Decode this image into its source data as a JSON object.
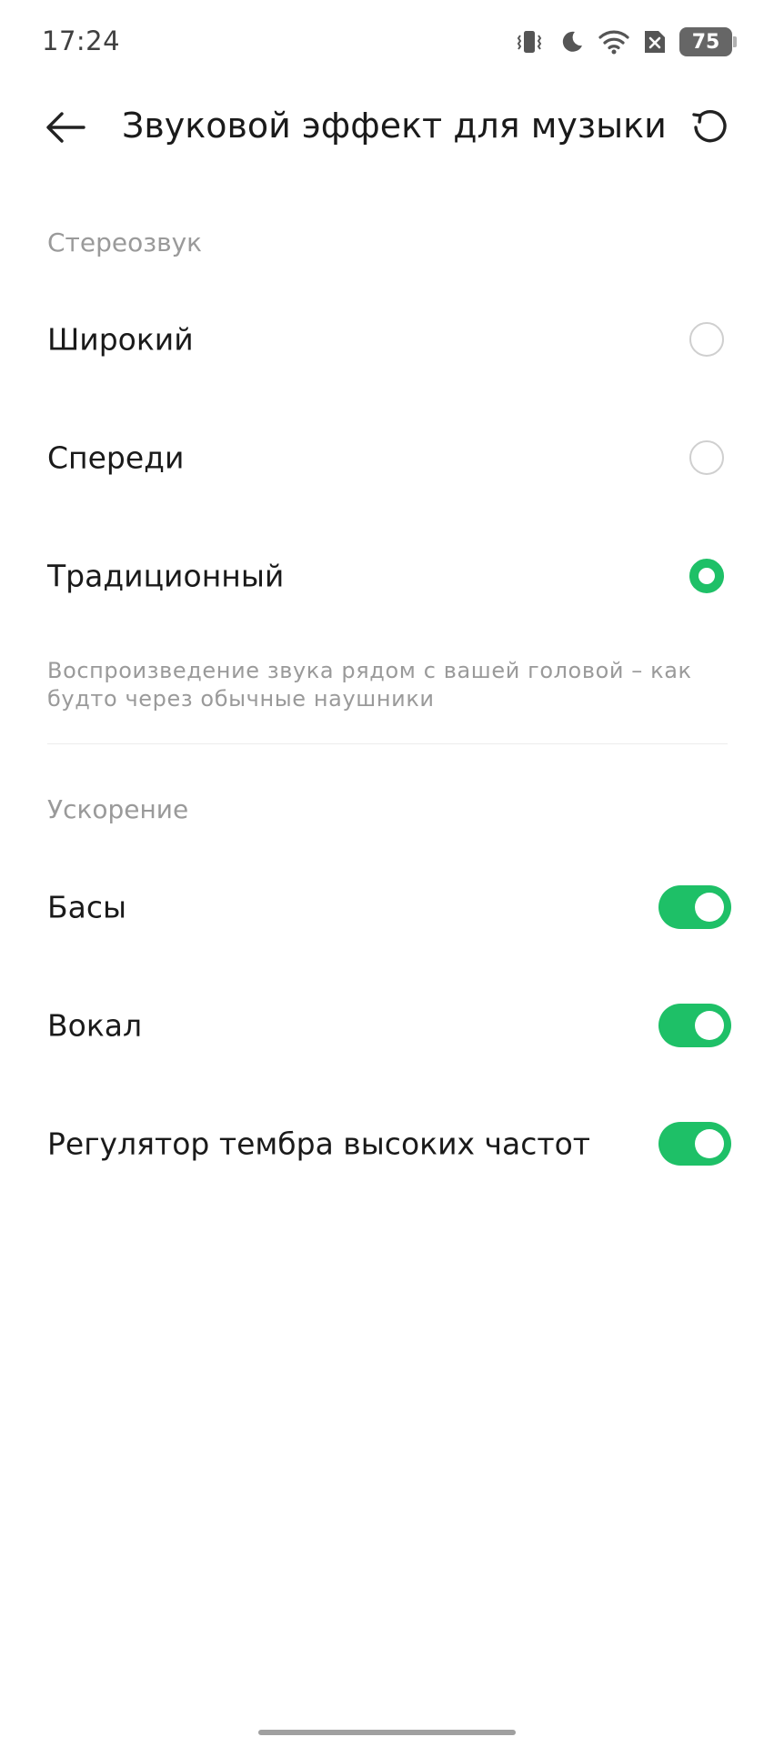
{
  "status_bar": {
    "time": "17:24",
    "icons": [
      "vibrate-icon",
      "moon-icon",
      "wifi-icon",
      "no-sim-icon"
    ],
    "battery_level": "75"
  },
  "header": {
    "title": "Звуковой эффект для музыки",
    "back_icon": "arrow-left-icon",
    "reset_icon": "reset-icon"
  },
  "stereo_section": {
    "title": "Стереозвук",
    "options": [
      {
        "label": "Широкий",
        "selected": false
      },
      {
        "label": "Спереди",
        "selected": false
      },
      {
        "label": "Традиционный",
        "selected": true
      }
    ],
    "description": "Воспроизведение звука рядом с вашей головой – как будто через обычные наушники"
  },
  "boost_section": {
    "title": "Ускорение",
    "toggles": [
      {
        "label": "Басы",
        "enabled": true
      },
      {
        "label": "Вокал",
        "enabled": true
      },
      {
        "label": "Регулятор тембра высоких частот",
        "enabled": true
      }
    ]
  },
  "colors": {
    "accent": "#1ec067",
    "secondary_text": "#9a9a9a",
    "primary_text": "#1a1a1a"
  }
}
